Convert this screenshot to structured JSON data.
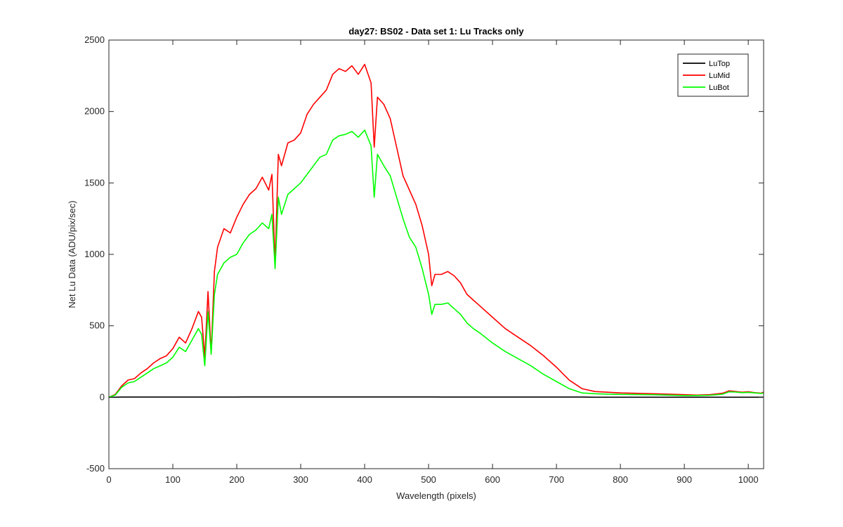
{
  "chart_data": {
    "type": "line",
    "title": "day27: BS02 - Data set 1: Lu Tracks only",
    "xlabel": "Wavelength (pixels)",
    "ylabel": "Net Lu Data (ADU/pix/sec)",
    "xlim": [
      0,
      1024
    ],
    "ylim": [
      -500,
      2500
    ],
    "xticks": [
      "0",
      "100",
      "200",
      "300",
      "400",
      "500",
      "600",
      "700",
      "800",
      "900",
      "1000"
    ],
    "yticks": [
      "-500",
      "0",
      "500",
      "1000",
      "1500",
      "2000",
      "2500"
    ],
    "grid": false,
    "legend_position": "top-right",
    "x": [
      0,
      10,
      20,
      30,
      40,
      50,
      60,
      70,
      80,
      90,
      100,
      110,
      120,
      130,
      140,
      145,
      150,
      155,
      160,
      165,
      170,
      180,
      190,
      200,
      210,
      220,
      230,
      240,
      250,
      255,
      260,
      265,
      270,
      280,
      290,
      300,
      310,
      320,
      330,
      340,
      350,
      360,
      370,
      380,
      390,
      400,
      410,
      415,
      420,
      430,
      440,
      450,
      460,
      470,
      480,
      490,
      500,
      505,
      510,
      520,
      530,
      540,
      550,
      560,
      570,
      580,
      600,
      620,
      640,
      660,
      680,
      700,
      720,
      740,
      760,
      780,
      800,
      850,
      900,
      920,
      940,
      960,
      970,
      980,
      990,
      1000,
      1010,
      1020,
      1024
    ],
    "series": [
      {
        "name": "LuTop",
        "color": "#000000",
        "values": [
          0,
          0,
          1,
          1,
          1,
          1,
          1,
          1,
          1,
          1,
          1,
          1,
          1,
          1,
          1,
          1,
          1,
          1,
          1,
          1,
          1,
          1,
          1,
          1,
          2,
          2,
          2,
          2,
          2,
          2,
          2,
          2,
          2,
          2,
          2,
          2,
          2,
          2,
          2,
          2,
          2,
          2,
          2,
          2,
          2,
          2,
          2,
          2,
          2,
          2,
          2,
          2,
          2,
          2,
          2,
          2,
          2,
          2,
          2,
          1,
          1,
          1,
          1,
          1,
          1,
          1,
          1,
          1,
          1,
          1,
          1,
          1,
          1,
          1,
          0,
          0,
          0,
          0,
          0,
          0,
          0,
          0,
          0,
          0,
          0,
          0,
          0,
          0,
          0
        ]
      },
      {
        "name": "LuMid",
        "color": "#ff0000",
        "values": [
          0,
          20,
          80,
          120,
          130,
          170,
          200,
          240,
          270,
          290,
          340,
          420,
          380,
          480,
          600,
          560,
          280,
          740,
          310,
          880,
          1050,
          1180,
          1150,
          1260,
          1350,
          1420,
          1460,
          1540,
          1450,
          1560,
          930,
          1700,
          1620,
          1780,
          1800,
          1850,
          1980,
          2050,
          2100,
          2150,
          2260,
          2300,
          2280,
          2320,
          2260,
          2330,
          2200,
          1750,
          2100,
          2050,
          1950,
          1750,
          1550,
          1450,
          1350,
          1200,
          1000,
          780,
          860,
          860,
          880,
          850,
          800,
          720,
          680,
          640,
          560,
          480,
          420,
          360,
          290,
          210,
          120,
          60,
          40,
          35,
          30,
          25,
          18,
          15,
          18,
          28,
          45,
          40,
          35,
          38,
          32,
          28,
          36
        ]
      },
      {
        "name": "LuBot",
        "color": "#00ff00",
        "values": [
          0,
          15,
          70,
          100,
          110,
          140,
          170,
          200,
          220,
          240,
          280,
          350,
          320,
          400,
          480,
          440,
          220,
          600,
          300,
          720,
          860,
          940,
          980,
          1000,
          1080,
          1140,
          1170,
          1220,
          1180,
          1280,
          900,
          1400,
          1280,
          1420,
          1460,
          1500,
          1560,
          1620,
          1680,
          1700,
          1800,
          1830,
          1840,
          1860,
          1820,
          1870,
          1760,
          1400,
          1700,
          1620,
          1550,
          1400,
          1250,
          1120,
          1050,
          900,
          720,
          580,
          650,
          650,
          660,
          620,
          580,
          520,
          480,
          450,
          380,
          320,
          270,
          220,
          160,
          110,
          60,
          30,
          25,
          22,
          20,
          18,
          12,
          12,
          14,
          22,
          38,
          36,
          32,
          34,
          30,
          26,
          30
        ]
      }
    ]
  }
}
